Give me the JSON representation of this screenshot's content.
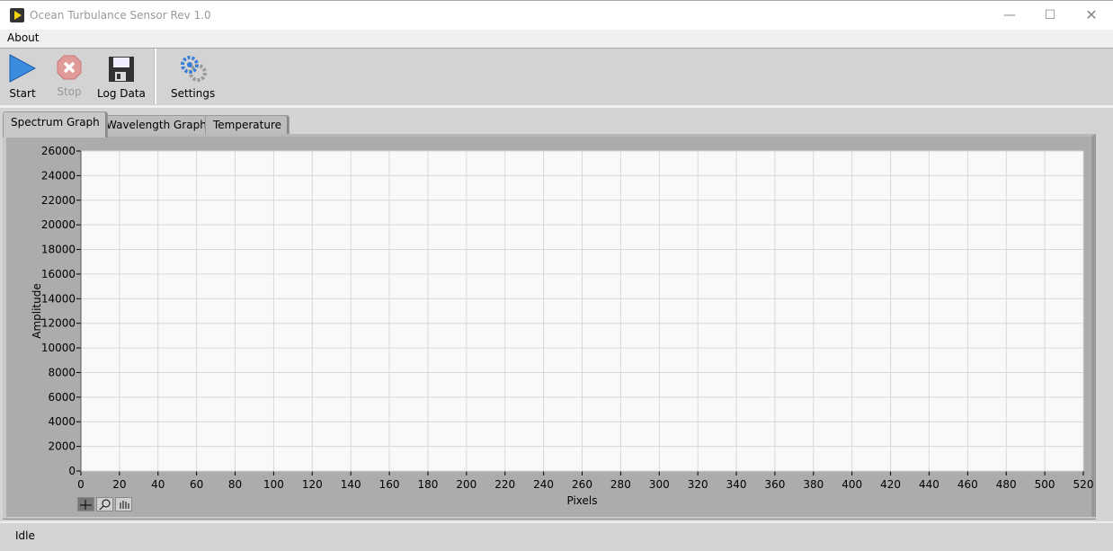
{
  "window": {
    "title": "Ocean Turbulance Sensor Rev 1.0"
  },
  "menu": {
    "items": [
      "About"
    ]
  },
  "toolbar": {
    "start": "Start",
    "stop": "Stop",
    "log": "Log Data",
    "settings": "Settings"
  },
  "tabs": [
    {
      "label": "Spectrum Graph",
      "active": true
    },
    {
      "label": "Wavelength Graph"
    },
    {
      "label": "Temperature"
    }
  ],
  "status": "Idle",
  "chart_data": {
    "type": "line",
    "series": [],
    "xlabel": "Pixels",
    "ylabel": "Amplitude",
    "xlim": [
      0,
      520
    ],
    "ylim": [
      0,
      26000
    ],
    "xstep": 20,
    "ystep": 2000,
    "grid": true,
    "colors": {
      "plot_bg": "#f9f9f9",
      "grid": "#d8d8d8"
    }
  }
}
